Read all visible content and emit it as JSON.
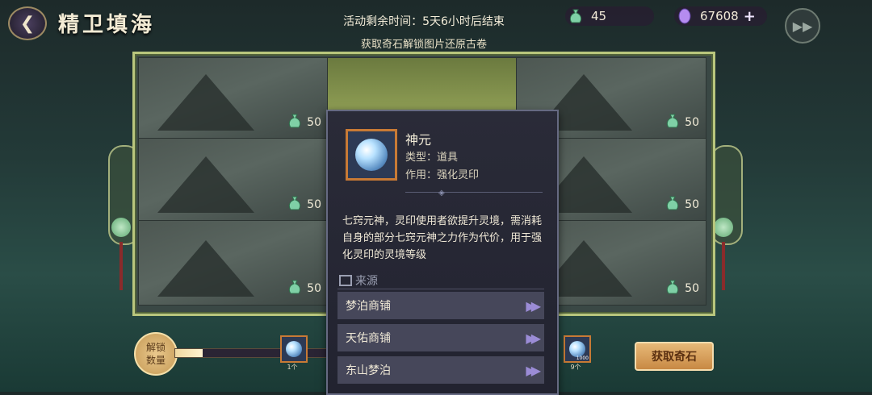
{
  "header": {
    "title": "精卫填海",
    "timer": "活动剩余时间：5天6小时后结束",
    "subtitle": "获取奇石解锁图片还原古卷",
    "currency1": "45",
    "currency2": "67608",
    "plus": "+"
  },
  "tiles": [
    {
      "cost": "50"
    },
    {
      "cost": ""
    },
    {
      "cost": "50"
    },
    {
      "cost": "50"
    },
    {
      "cost": ""
    },
    {
      "cost": "50"
    },
    {
      "cost": "50"
    },
    {
      "cost": ""
    },
    {
      "cost": "50"
    }
  ],
  "popup": {
    "name": "神元",
    "type": "类型：道具",
    "use": "作用：强化灵印",
    "description": "七窍元神，灵印使用者欲提升灵境，需消耗自身的部分七窍元神之力作为代价，用于强化灵印的灵境等级",
    "source_title": "来源",
    "sources": [
      "梦泊商铺",
      "天佑商铺",
      "东山梦泊"
    ]
  },
  "bottom": {
    "unlock_label": "解锁数量",
    "progress": 0.18,
    "reward1_count": "1个",
    "reward2_count": "9个",
    "reward2_badge": "1000",
    "get_button": "获取奇石"
  }
}
